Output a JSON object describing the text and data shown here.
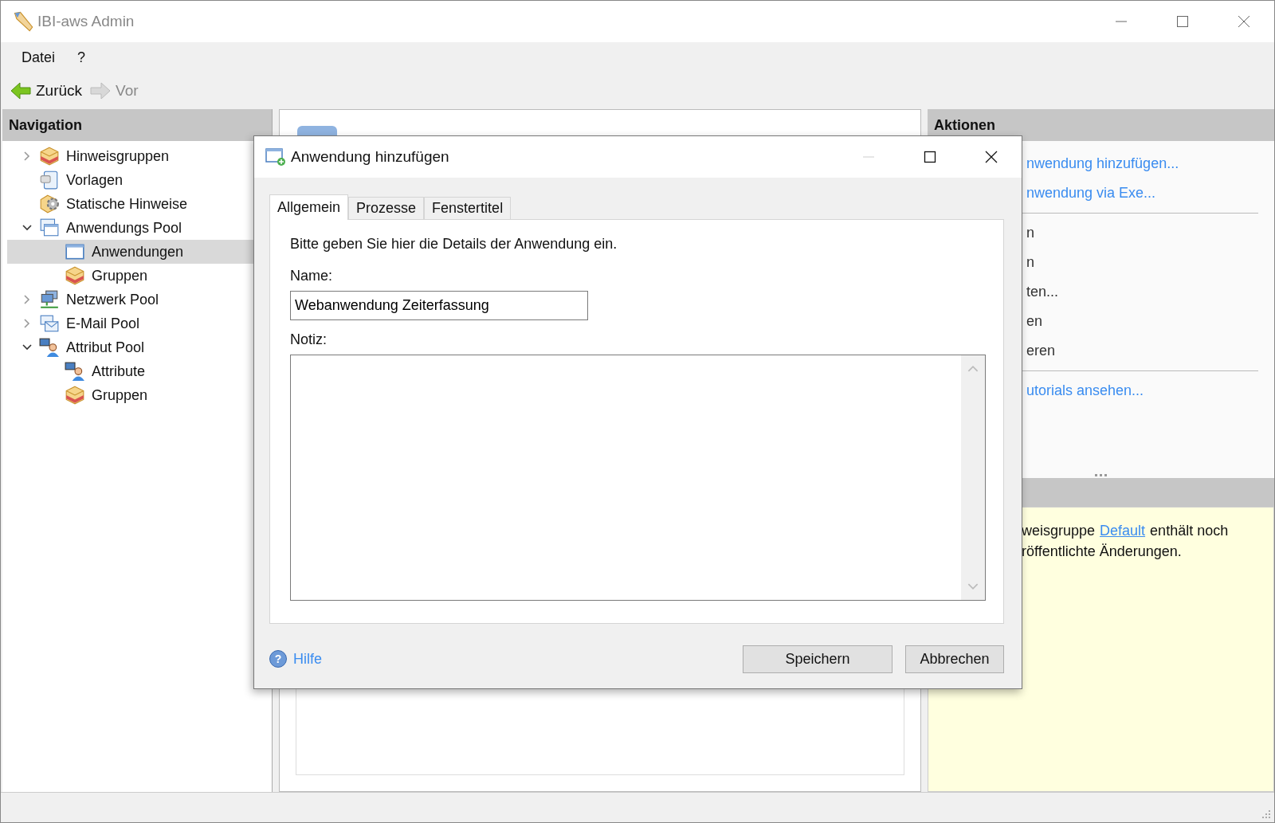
{
  "window": {
    "title": "IBI-aws Admin"
  },
  "menu": [
    "Datei",
    "?"
  ],
  "toolbar": [
    {
      "label": "Zurück",
      "disabled": false
    },
    {
      "label": "Vor",
      "disabled": true
    }
  ],
  "navigation": {
    "title": "Navigation",
    "tree": [
      {
        "label": "Hinweisgruppen",
        "kind": "box",
        "expanded": false,
        "selected": false
      },
      {
        "label": "Vorlagen",
        "kind": "document",
        "selected": false
      },
      {
        "label": "Statische Hinweise",
        "kind": "gear",
        "selected": false
      },
      {
        "label": "Anwendungs Pool",
        "kind": "windows",
        "expanded": true,
        "selected": false,
        "children": [
          {
            "label": "Anwendungen",
            "kind": "window",
            "selected": true
          },
          {
            "label": "Gruppen",
            "kind": "box",
            "selected": false
          }
        ]
      },
      {
        "label": "Netzwerk Pool",
        "kind": "network",
        "expanded": false,
        "selected": false
      },
      {
        "label": "E-Mail Pool",
        "kind": "mail",
        "expanded": false,
        "selected": false
      },
      {
        "label": "Attribut Pool",
        "kind": "person",
        "expanded": true,
        "selected": false,
        "children": [
          {
            "label": "Attribute",
            "kind": "person",
            "selected": false
          },
          {
            "label": "Gruppen",
            "kind": "box",
            "selected": false
          }
        ]
      }
    ]
  },
  "actions": {
    "title": "Aktionen",
    "groups": [
      [
        {
          "label": "nwendung hinzufügen...",
          "kind": "link"
        },
        {
          "label": "nwendung via Exe...",
          "kind": "link"
        }
      ],
      [
        {
          "label": "n",
          "kind": "text"
        },
        {
          "label": "n",
          "kind": "text"
        },
        {
          "label": "ten...",
          "kind": "text"
        },
        {
          "label": "en",
          "kind": "text"
        },
        {
          "label": "eren",
          "kind": "text"
        }
      ],
      [
        {
          "label": "utorials ansehen...",
          "kind": "link"
        }
      ]
    ],
    "notice": [
      {
        "text": "weisgruppe",
        "link": "Default",
        "after": "enthält noch"
      },
      {
        "text": "röffentlichte Änderungen."
      }
    ]
  },
  "dialog": {
    "title": "Anwendung hinzufügen",
    "tabs": [
      {
        "label": "Allgemein",
        "selected": true
      },
      {
        "label": "Prozesse",
        "selected": false
      },
      {
        "label": "Fenstertitel",
        "selected": false
      }
    ],
    "intro": "Bitte geben Sie hier die Details der Anwendung ein.",
    "name": {
      "label": "Name:",
      "value": "Webanwendung Zeiterfassung"
    },
    "note": {
      "label": "Notiz:"
    },
    "help_icon": "?",
    "help": "Hilfe",
    "buttons": [
      "Speichern",
      "Abbrechen"
    ]
  }
}
